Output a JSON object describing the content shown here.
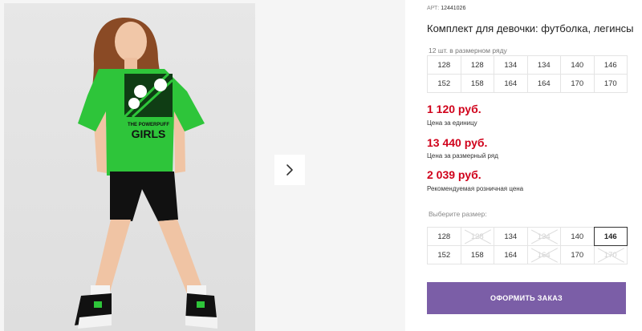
{
  "product": {
    "article_label": "АРТ:",
    "article_value": "12441026",
    "title": "Комплект для девочки: футболка, легинсы"
  },
  "gallery": {
    "shirt_text_top": "THE POWERPUFF",
    "shirt_text_bottom": "GIRLS",
    "icons": {
      "next": "chevron-right-icon"
    },
    "colors": {
      "shirt": "#2ec53a",
      "shorts": "#111111"
    }
  },
  "pack": {
    "label": "12 шт. в размерном ряду",
    "sizes": [
      "128",
      "128",
      "134",
      "134",
      "140",
      "146",
      "152",
      "158",
      "164",
      "164",
      "170",
      "170"
    ]
  },
  "prices": {
    "unit": {
      "value": "1 120 руб.",
      "label": "Цена за единицу"
    },
    "pack": {
      "value": "13 440 руб.",
      "label": "Цена за размерный ряд"
    },
    "retail": {
      "value": "2 039 руб.",
      "label": "Рекомендуемая розничная цена"
    }
  },
  "size_selector": {
    "label": "Выберите размер:",
    "options": [
      {
        "size": "128",
        "available": true
      },
      {
        "size": "128",
        "available": false
      },
      {
        "size": "134",
        "available": true
      },
      {
        "size": "134",
        "available": false
      },
      {
        "size": "140",
        "available": true
      },
      {
        "size": "146",
        "available": true,
        "selected": true
      },
      {
        "size": "152",
        "available": true
      },
      {
        "size": "158",
        "available": true
      },
      {
        "size": "164",
        "available": true
      },
      {
        "size": "164",
        "available": false
      },
      {
        "size": "170",
        "available": true
      },
      {
        "size": "170",
        "available": false
      }
    ]
  },
  "order_button": {
    "label": "ОФОРМИТЬ ЗАКАЗ",
    "color": "#7b5ea7"
  },
  "price_color": "#d0021b"
}
